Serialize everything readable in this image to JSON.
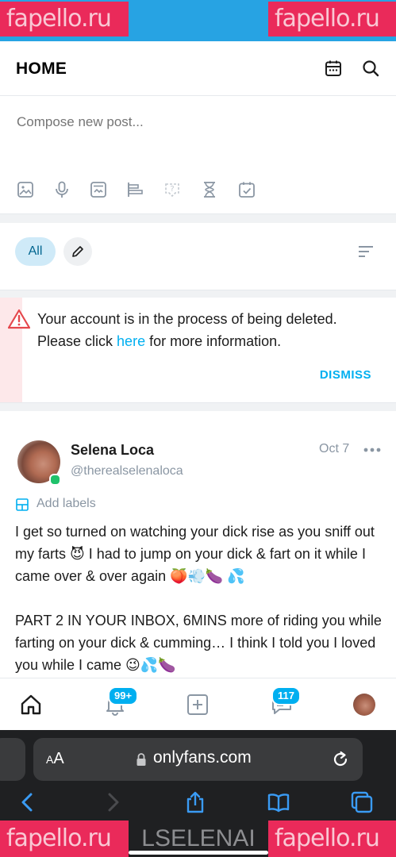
{
  "watermark": "fapello.ru",
  "header": {
    "title": "HOME",
    "icons": [
      "calendar-icon",
      "search-icon"
    ]
  },
  "compose": {
    "placeholder": "Compose new post...",
    "tools": [
      "image-icon",
      "microphone-icon",
      "media-vault-icon",
      "poll-icon",
      "quiz-icon",
      "expiration-timer-icon",
      "schedule-icon"
    ]
  },
  "filters": {
    "all_label": "All",
    "icons": [
      "pencil-icon",
      "sort-icon"
    ]
  },
  "alert": {
    "line1": "Your account is in the process of being deleted.",
    "before_link": "Please click ",
    "link": "here",
    "after_link": " for more information.",
    "dismiss": "DISMISS"
  },
  "post": {
    "author_name": "Selena Loca",
    "author_handle": "@therealselenaloca",
    "date": "Oct 7",
    "labels": "Add labels",
    "paragraph1": "I get so turned on watching your dick rise as you sniff out my farts 😈 I had to jump on your dick & fart on it while I came over & over again 🍑💨🍆 💦",
    "paragraph2": "PART 2 IN YOUR INBOX, 6MINS more of riding you while farting on your dick & cumming… I think I told you I loved you while I came 😉💦🍆"
  },
  "bottom_nav": {
    "items": [
      "home-icon",
      "notifications-icon",
      "add-post-icon",
      "messages-icon",
      "profile-avatar"
    ],
    "notifications_badge": "99+",
    "messages_badge": "117"
  },
  "browser": {
    "aa_label_small": "A",
    "aa_label_large": "A",
    "url": "onlyfans.com",
    "toolbar": [
      "back-icon",
      "forward-icon",
      "share-icon",
      "bookmarks-icon",
      "tabs-icon"
    ],
    "overlay_text": "LSELENAI"
  },
  "colors": {
    "accent": "#00aff0",
    "alert": "#e5484d",
    "status_strip": "#27a3e3",
    "watermark": "#ea2a5a"
  }
}
